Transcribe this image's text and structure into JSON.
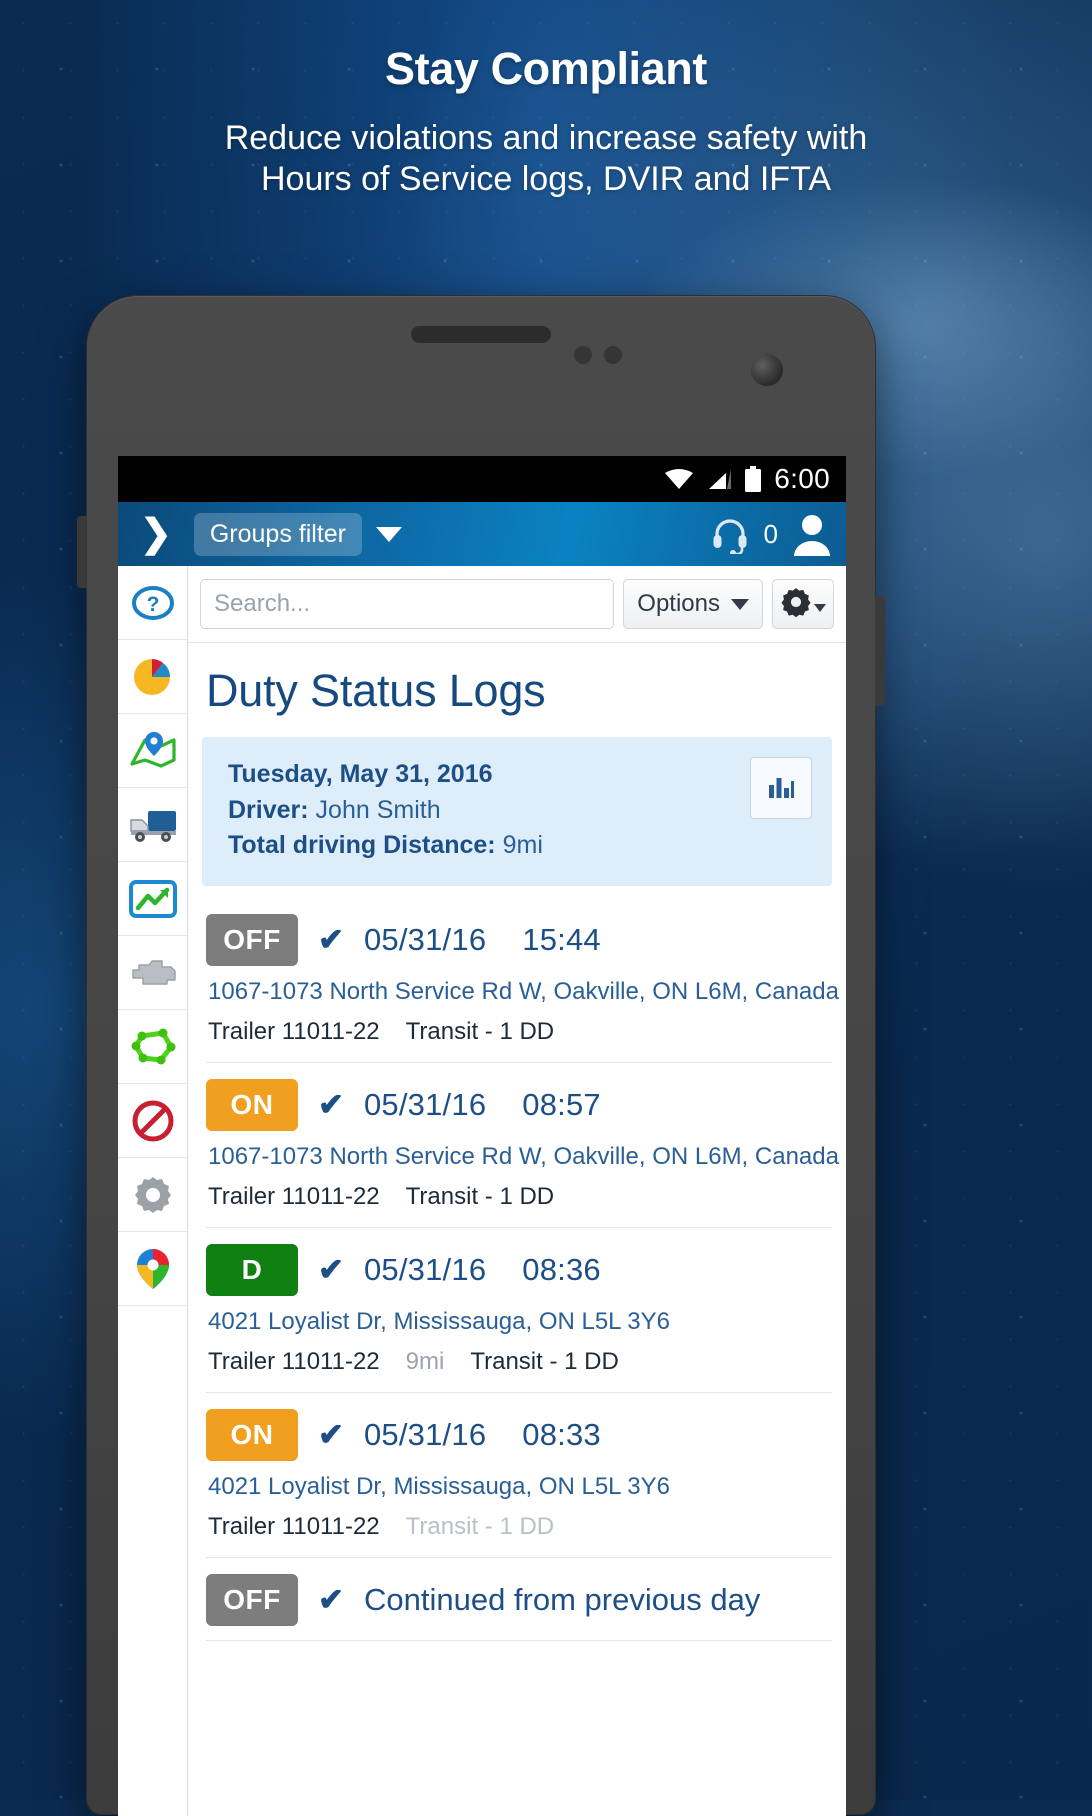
{
  "promo": {
    "title": "Stay Compliant",
    "subtitle_line1": "Reduce violations and increase safety with",
    "subtitle_line2": "Hours of Service logs, DVIR and IFTA"
  },
  "status_bar": {
    "time": "6:00",
    "icons": [
      "wifi-icon",
      "signal-icon",
      "battery-icon"
    ]
  },
  "appbar": {
    "menu_icon": "chevron-right-icon",
    "groups_filter_label": "Groups filter",
    "dropdown_icon": "caret-down-icon",
    "support_icon": "headset-icon",
    "message_count": "0",
    "avatar_icon": "user-avatar-icon",
    "accent_color": "#0d6ba8"
  },
  "sidebar": {
    "items": [
      {
        "name": "help",
        "icon": "question-circle-icon"
      },
      {
        "name": "dashboard",
        "icon": "pie-chart-icon"
      },
      {
        "name": "map",
        "icon": "map-pin-icon"
      },
      {
        "name": "vehicles",
        "icon": "truck-icon"
      },
      {
        "name": "activity",
        "icon": "line-chart-icon"
      },
      {
        "name": "engine",
        "icon": "engine-icon"
      },
      {
        "name": "zones",
        "icon": "polygon-zone-icon"
      },
      {
        "name": "rules",
        "icon": "prohibited-icon"
      },
      {
        "name": "settings",
        "icon": "gear-icon"
      },
      {
        "name": "marketplace",
        "icon": "color-pin-icon"
      }
    ]
  },
  "toolbar": {
    "search_placeholder": "Search...",
    "options_label": "Options",
    "options_caret_icon": "caret-down-icon",
    "gear_icon": "gear-icon"
  },
  "page": {
    "title": "Duty Status Logs"
  },
  "summary": {
    "date": "Tuesday, May 31, 2016",
    "driver_label": "Driver:",
    "driver_name": "John Smith",
    "distance_label": "Total driving Distance:",
    "distance_value": "9mi",
    "chart_button_icon": "bar-chart-icon"
  },
  "logs": [
    {
      "status": "OFF",
      "status_color": "#7d7d7d",
      "verified_icon": "check-icon",
      "date": "05/31/16",
      "time": "15:44",
      "address": "1067-1073 North Service Rd W, Oakville, ON L6M, Canada",
      "trailer": "Trailer 11011-22",
      "distance": "",
      "note": "Transit  - 1 DD"
    },
    {
      "status": "ON",
      "status_color": "#f0a01e",
      "verified_icon": "check-icon",
      "date": "05/31/16",
      "time": "08:57",
      "address": "1067-1073 North Service Rd W, Oakville, ON L6M, Canada",
      "trailer": "Trailer 11011-22",
      "distance": "",
      "note": "Transit  - 1 DD"
    },
    {
      "status": "D",
      "status_color": "#118012",
      "verified_icon": "check-icon",
      "date": "05/31/16",
      "time": "08:36",
      "address": "4021 Loyalist Dr, Mississauga, ON L5L 3Y6",
      "trailer": "Trailer 11011-22",
      "distance": "9mi",
      "note": "Transit  - 1 DD"
    },
    {
      "status": "ON",
      "status_color": "#f0a01e",
      "verified_icon": "check-icon",
      "date": "05/31/16",
      "time": "08:33",
      "address": "4021 Loyalist Dr, Mississauga, ON L5L 3Y6",
      "trailer": "Trailer 11011-22",
      "distance": "",
      "note": "Transit  - 1 DD"
    },
    {
      "status": "OFF",
      "status_color": "#7d7d7d",
      "verified_icon": "check-icon",
      "continued_text": "Continued from previous day",
      "date": "",
      "time": "",
      "address": "",
      "trailer": "",
      "distance": "",
      "note": ""
    }
  ]
}
